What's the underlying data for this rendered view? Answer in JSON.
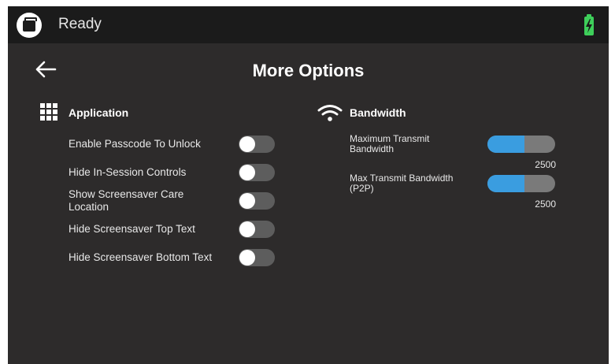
{
  "status_bar": {
    "status": "Ready",
    "app_icon": "tv-icon",
    "battery_icon": "battery-charging-icon",
    "battery_color": "#3ecf5a"
  },
  "header": {
    "back_icon": "arrow-left-icon",
    "title": "More Options"
  },
  "application": {
    "icon": "grid-icon",
    "title": "Application",
    "options": [
      {
        "label": "Enable Passcode To Unlock",
        "enabled": false
      },
      {
        "label": "Hide In-Session Controls",
        "enabled": false
      },
      {
        "label": "Show Screensaver Care Location",
        "enabled": false
      },
      {
        "label": "Hide Screensaver Top Text",
        "enabled": false
      },
      {
        "label": "Hide Screensaver Bottom Text",
        "enabled": false
      }
    ]
  },
  "bandwidth": {
    "icon": "wifi-icon",
    "title": "Bandwidth",
    "accent_color": "#3a9de0",
    "settings": [
      {
        "label": "Maximum Transmit Bandwidth",
        "value": "2500",
        "level_fraction": 0.55
      },
      {
        "label": "Max Transmit Bandwidth (P2P)",
        "value": "2500",
        "level_fraction": 0.55
      }
    ]
  }
}
